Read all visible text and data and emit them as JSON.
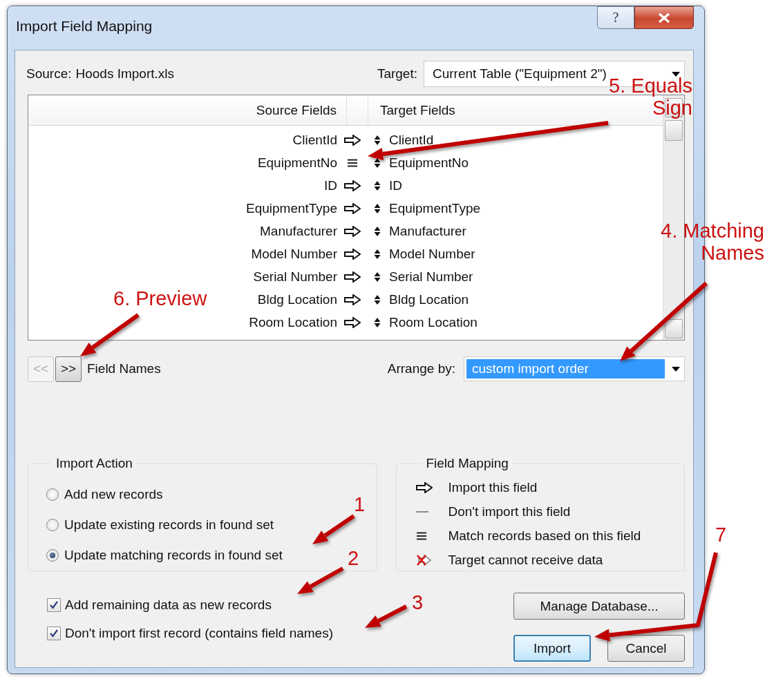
{
  "window": {
    "title": "Import Field Mapping",
    "help_button": "?"
  },
  "source": {
    "label": "Source:",
    "value": "Hoods Import.xls"
  },
  "target": {
    "label": "Target:",
    "value": "Current Table (\"Equipment 2\")"
  },
  "mapping_list": {
    "columns": [
      "Source Fields",
      "Target Fields"
    ],
    "rows": [
      {
        "source": "ClientId",
        "kind": "import",
        "target": "ClientId"
      },
      {
        "source": "EquipmentNo",
        "kind": "match",
        "target": "EquipmentNo"
      },
      {
        "source": "ID",
        "kind": "import",
        "target": "ID"
      },
      {
        "source": "EquipmentType",
        "kind": "import",
        "target": "EquipmentType"
      },
      {
        "source": "Manufacturer",
        "kind": "import",
        "target": "Manufacturer"
      },
      {
        "source": "Model Number",
        "kind": "import",
        "target": "Model Number"
      },
      {
        "source": "Serial Number",
        "kind": "import",
        "target": "Serial Number"
      },
      {
        "source": "Bldg Location",
        "kind": "import",
        "target": "Bldg Location"
      },
      {
        "source": "Room Location",
        "kind": "import",
        "target": "Room Location"
      }
    ]
  },
  "preview_nav": {
    "prev": {
      "label": "<<",
      "disabled": true
    },
    "next": {
      "label": ">>",
      "disabled": false
    },
    "label": "Field Names"
  },
  "arrange_by": {
    "label": "Arrange by:",
    "value": "custom import order"
  },
  "import_action": {
    "title": "Import Action",
    "options": [
      {
        "label": "Add new records",
        "selected": false
      },
      {
        "label": "Update existing records in found set",
        "selected": false
      },
      {
        "label": "Update matching records in found set",
        "selected": true
      }
    ]
  },
  "field_mapping_legend": {
    "title": "Field Mapping",
    "items": [
      {
        "kind": "import",
        "label": "Import this field"
      },
      {
        "kind": "skip",
        "label": "Don't import this field"
      },
      {
        "kind": "match",
        "label": "Match records based on this field"
      },
      {
        "kind": "blocked",
        "label": "Target cannot receive data"
      }
    ]
  },
  "options": [
    {
      "label": "Add remaining data as new records",
      "checked": true
    },
    {
      "label": "Don't import first record (contains field names)",
      "checked": true
    }
  ],
  "buttons": [
    {
      "label": "Manage Database...",
      "default": false
    },
    {
      "label": "Import",
      "default": true
    },
    {
      "label": "Cancel",
      "default": false
    }
  ],
  "annotations": [
    {
      "lines": [
        "5. Equals",
        "Sign"
      ]
    },
    {
      "lines": [
        "4. Matching",
        "Names"
      ]
    },
    {
      "lines": [
        "6. Preview"
      ]
    },
    {
      "lines": [
        "1"
      ]
    },
    {
      "lines": [
        "2"
      ]
    },
    {
      "lines": [
        "3"
      ]
    },
    {
      "lines": [
        "7"
      ]
    }
  ]
}
